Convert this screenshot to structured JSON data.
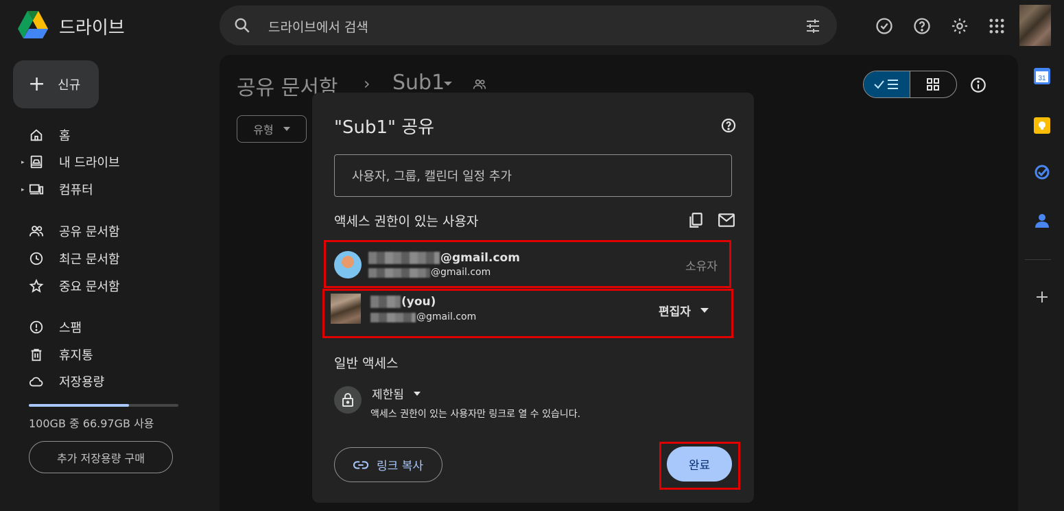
{
  "app": {
    "title": "드라이브"
  },
  "search": {
    "placeholder": "드라이브에서 검색"
  },
  "sidebar": {
    "new_label": "신규",
    "items": [
      {
        "label": "홈"
      },
      {
        "label": "내 드라이브"
      },
      {
        "label": "컴퓨터"
      },
      {
        "label": "공유 문서함"
      },
      {
        "label": "최근 문서함"
      },
      {
        "label": "중요 문서함"
      },
      {
        "label": "스팸"
      },
      {
        "label": "휴지통"
      },
      {
        "label": "저장용량"
      }
    ],
    "storage_text": "100GB 중 66.97GB 사용",
    "storage_used_fraction": 0.67,
    "buy_label": "추가 저장용량 구매"
  },
  "main": {
    "breadcrumb_parent": "공유 문서함",
    "breadcrumb_sep": "›",
    "folder_name": "Sub1",
    "type_filter": "유형"
  },
  "rail": {
    "calendar_day": "31"
  },
  "dialog": {
    "title": "\"Sub1\" 공유",
    "add_placeholder": "사용자, 그룹, 캘린더 일정 추가",
    "people_section": "액세스 권한이 있는 사용자",
    "people": [
      {
        "name": "@gmail.com",
        "email": "@gmail.com",
        "role": "소유자"
      },
      {
        "name": "(you)",
        "email": "@gmail.com",
        "role": "편집자"
      }
    ],
    "general_section": "일반 액세스",
    "access_level": "제한됨",
    "access_desc": "액세스 권한이 있는 사용자만 링크로 열 수 있습니다.",
    "copy_link": "링크 복사",
    "done": "완료"
  },
  "colors": {
    "accent": "#a8c7fa",
    "highlight": "#e00000",
    "toggle_on": "#004a77"
  }
}
